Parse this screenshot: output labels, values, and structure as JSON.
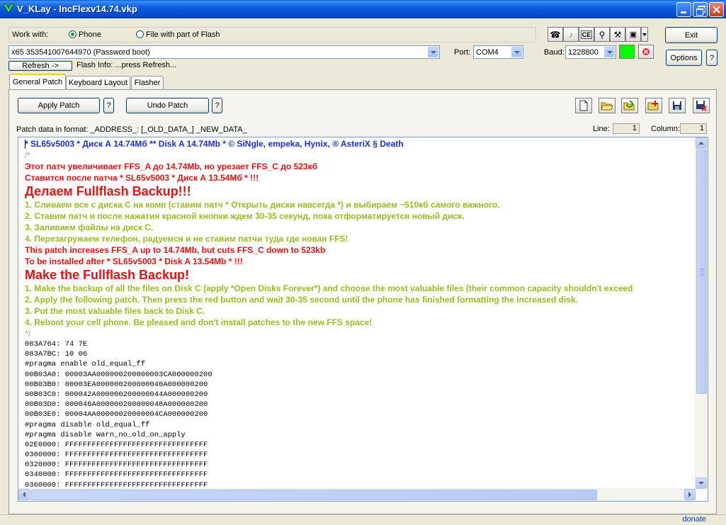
{
  "window": {
    "title": "V_KLay - IncFlexv14.74.vkp"
  },
  "top": {
    "work_with_label": "Work with:",
    "radio_phone": "Phone",
    "radio_file": "File with part of Flash",
    "device_value": "x65 353541007644970 (Password boot)",
    "refresh_label": "Refresh ->",
    "flash_info": "Flash Info: ...press Refresh...",
    "port_label": "Port:",
    "port_value": "COM4",
    "baud_label": "Baud:",
    "baud_value": "1228800",
    "exit_label": "Exit",
    "options_label": "Options",
    "help_label": "?"
  },
  "tabs": [
    "General Patch",
    "Keyboard Layout",
    "Flasher"
  ],
  "panel": {
    "apply_label": "Apply Patch",
    "undo_label": "Undo Patch",
    "help_label": "?",
    "format_text": "Patch data in format: _ADDRESS_: [_OLD_DATA_] _NEW_DATA_",
    "line_label": "Line:",
    "line_value": "1",
    "column_label": "Column:",
    "column_value": "1"
  },
  "editor_lines": [
    {
      "t": "* SL65v5003 * Диск А 14.74Мб ** Disk A 14.74Mb * © SiNgle, empeka, Hynix, ® AsteriX § Death",
      "c": "blue"
    },
    {
      "t": "/*",
      "c": "gray"
    },
    {
      "t": "Этот патч увеличивает FFS_A до 14.74Mb, но урезает FFS_C до 523кб",
      "c": "red"
    },
    {
      "t": "Ставится после патча * SL65v5003 * Диск А 13.54Мб * !!!",
      "c": "red"
    },
    {
      "t": "Делаем Fullflash Backup!!!",
      "c": "red",
      "big": true
    },
    {
      "t": "1. Сливаем все с диска C на комп (ставим патч * Открыть диски навсегда *) и выбираем ~510кб самого важного.",
      "c": "green"
    },
    {
      "t": "2. Ставим патч и после нажатия красной кнопки ждем 30-35 секунд, пока отформатируется новый диск.",
      "c": "green"
    },
    {
      "t": "3. Заливаем файлы на диск C.",
      "c": "green"
    },
    {
      "t": "4. Перезагружаем телефон, радуемся и не ставим патчи туда где новая FFS!",
      "c": "green"
    },
    {
      "t": "This patch increases FFS_A up to 14.74Mb, but cuts FFS_C down to 523kb",
      "c": "red"
    },
    {
      "t": "To be installed after * SL65v5003 * Disk A 13.54Mb * !!!",
      "c": "red"
    },
    {
      "t": "Make the Fullflash Backup!",
      "c": "red",
      "big": true
    },
    {
      "t": "1. Make the backup of all the files on Disk C (apply *Open Disks Forever*) and choose the most valuable files (their common capacity shouldn't exceed",
      "c": "green"
    },
    {
      "t": "2. Apply the following patch. Then press the red button and wait 30-35 second until the phone has finished formatting the increased disk.",
      "c": "green"
    },
    {
      "t": "3. Put the most valuable files back to Disk C.",
      "c": "green"
    },
    {
      "t": "4. Reboot your cell phone. Be pleased and don't install patches to the new FFS space!",
      "c": "green"
    },
    {
      "t": "*/",
      "c": "gray"
    },
    {
      "t": "083A764: 74 7E",
      "c": "black",
      "mono": true
    },
    {
      "t": "083A7BC: 10 06",
      "c": "black",
      "mono": true
    },
    {
      "t": "#pragma enable old_equal_ff",
      "c": "black",
      "mono": true
    },
    {
      "t": "00B03A0: 00003AA000000200000003CA000000200",
      "c": "black",
      "mono": true
    },
    {
      "t": "00B03B0: 00003EA000000200000040A000000200",
      "c": "black",
      "mono": true
    },
    {
      "t": "00B03C0: 000042A000000200000044A000000200",
      "c": "black",
      "mono": true
    },
    {
      "t": "00B03D0: 000046A000000200000048A000000200",
      "c": "black",
      "mono": true
    },
    {
      "t": "00B03E0: 00004AA00000020000004CA000000200",
      "c": "black",
      "mono": true
    },
    {
      "t": "#pragma disable old_equal_ff",
      "c": "black",
      "mono": true
    },
    {
      "t": "#pragma disable warn_no_old_on_apply",
      "c": "black",
      "mono": true
    },
    {
      "t": "02E0000: FFFFFFFFFFFFFFFFFFFFFFFFFFFFFFFF",
      "c": "black",
      "mono": true
    },
    {
      "t": "0300000: FFFFFFFFFFFFFFFFFFFFFFFFFFFFFFFF",
      "c": "black",
      "mono": true
    },
    {
      "t": "0320000: FFFFFFFFFFFFFFFFFFFFFFFFFFFFFFFF",
      "c": "black",
      "mono": true
    },
    {
      "t": "0340000: FFFFFFFFFFFFFFFFFFFFFFFFFFFFFFFF",
      "c": "black",
      "mono": true
    },
    {
      "t": "0360000: FFFFFFFFFFFFFFFFFFFFFFFFFFFFFFFF",
      "c": "black",
      "mono": true
    }
  ],
  "status": {
    "donate": "donate"
  },
  "colors": {
    "accent": "#0a5fd8",
    "status_green": "#00ff00"
  }
}
